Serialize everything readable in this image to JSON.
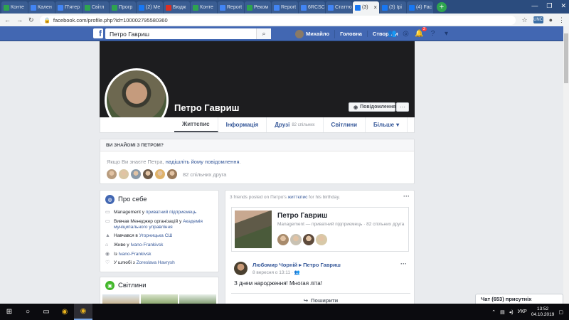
{
  "browser": {
    "tabs": [
      {
        "label": "Конте",
        "color": "#2ea44f"
      },
      {
        "label": "Кален",
        "color": "#4285f4"
      },
      {
        "label": "П'ятер",
        "color": "#4285f4"
      },
      {
        "label": "Світл",
        "color": "#2ea44f"
      },
      {
        "label": "Прогр",
        "color": "#2ea44f"
      },
      {
        "label": "(2) Ме",
        "color": "#1877f2"
      },
      {
        "label": "Бюдж",
        "color": "#d93025"
      },
      {
        "label": "Конте",
        "color": "#2ea44f"
      },
      {
        "label": "Report",
        "color": "#4285f4"
      },
      {
        "label": "Реком",
        "color": "#2ea44f"
      },
      {
        "label": "Report",
        "color": "#4285f4"
      },
      {
        "label": "6RCSC",
        "color": "#4285f4"
      },
      {
        "label": "Статтю",
        "color": "#4285f4"
      },
      {
        "label": "(3)",
        "color": "#1877f2",
        "active": true
      },
      {
        "label": "(3) Ірі",
        "color": "#1877f2"
      },
      {
        "label": "(4) Fac",
        "color": "#1877f2"
      }
    ],
    "url": "facebook.com/profile.php?id=100002795580360",
    "ext_label": "UNC"
  },
  "fb": {
    "search_value": "Петро Гавриш",
    "nav": {
      "user": "Михайло",
      "home": "Головна",
      "create": "Створити"
    },
    "notif_badge": "2"
  },
  "profile": {
    "name": "Петро Гавриш",
    "message_btn": "Повідомлення",
    "more_btn": "···",
    "tabs": {
      "timeline": "Життєпис",
      "info": "Інформація",
      "friends": "Друзі",
      "friends_count": "82 спільних",
      "photos": "Світлини",
      "more": "Більше"
    }
  },
  "youknow": {
    "header": "ВИ ЗНАЙОМІ З ПЕТРОМ?",
    "line_prefix": "Якщо Ви знаєте Петра, ",
    "line_link": "надішліть йому повідомлення",
    "line_suffix": ".",
    "mutual": "82 спільних друга",
    "friend_colors": [
      "#b89c7e",
      "#d9c7a4",
      "#8a9aa8",
      "#6d5a48",
      "#e0b36a",
      "#9a7a5a"
    ]
  },
  "about": {
    "title": "Про себе",
    "rows": [
      {
        "icon": "briefcase-icon",
        "glyph": "▭",
        "pre": "Management у ",
        "link": "приватний підприємець",
        "post": ""
      },
      {
        "icon": "briefcase-icon",
        "glyph": "▭",
        "pre": "Вивчав Менеджер організацій у ",
        "link": "Академія муніципального управління",
        "post": ""
      },
      {
        "icon": "graduation-icon",
        "glyph": "▲",
        "pre": "Навчався в ",
        "link": "Угорницька СШ",
        "post": ""
      },
      {
        "icon": "home-icon",
        "glyph": "⌂",
        "pre": "Живе у ",
        "link": "Ivano-Frankivsk",
        "post": ""
      },
      {
        "icon": "location-icon",
        "glyph": "◉",
        "pre": "Із ",
        "link": "Ivano-Frankivsk",
        "post": ""
      },
      {
        "icon": "heart-icon",
        "glyph": "♡",
        "pre": "У шлюбі з ",
        "link": "Zoreslava Havrysh",
        "post": ""
      }
    ]
  },
  "photos": {
    "title": "Світлини"
  },
  "birthday": {
    "prefix": "3 friends posted on Петро's ",
    "link": "життєпис",
    "suffix": " for his birthday.",
    "card_name": "Петро Гавриш",
    "card_sub": "Management — приватний підприємець · 82 спільних друга",
    "card_friend_colors": [
      "#a88b6c",
      "#c9c2b3",
      "#5e4b3c",
      "#d8c9a8"
    ]
  },
  "post": {
    "author": "Любомир Чорній",
    "arrow": " ▸ ",
    "target": "Петро Гавриш",
    "date": "8 вересня о 13:11 · ",
    "text": "З днем народження! Многая літа!",
    "share": "Поширити"
  },
  "chat": {
    "label": "Чат (653) присутніх"
  },
  "taskbar": {
    "lang": "УКР",
    "time": "13:52",
    "date": "04.10.2019"
  }
}
